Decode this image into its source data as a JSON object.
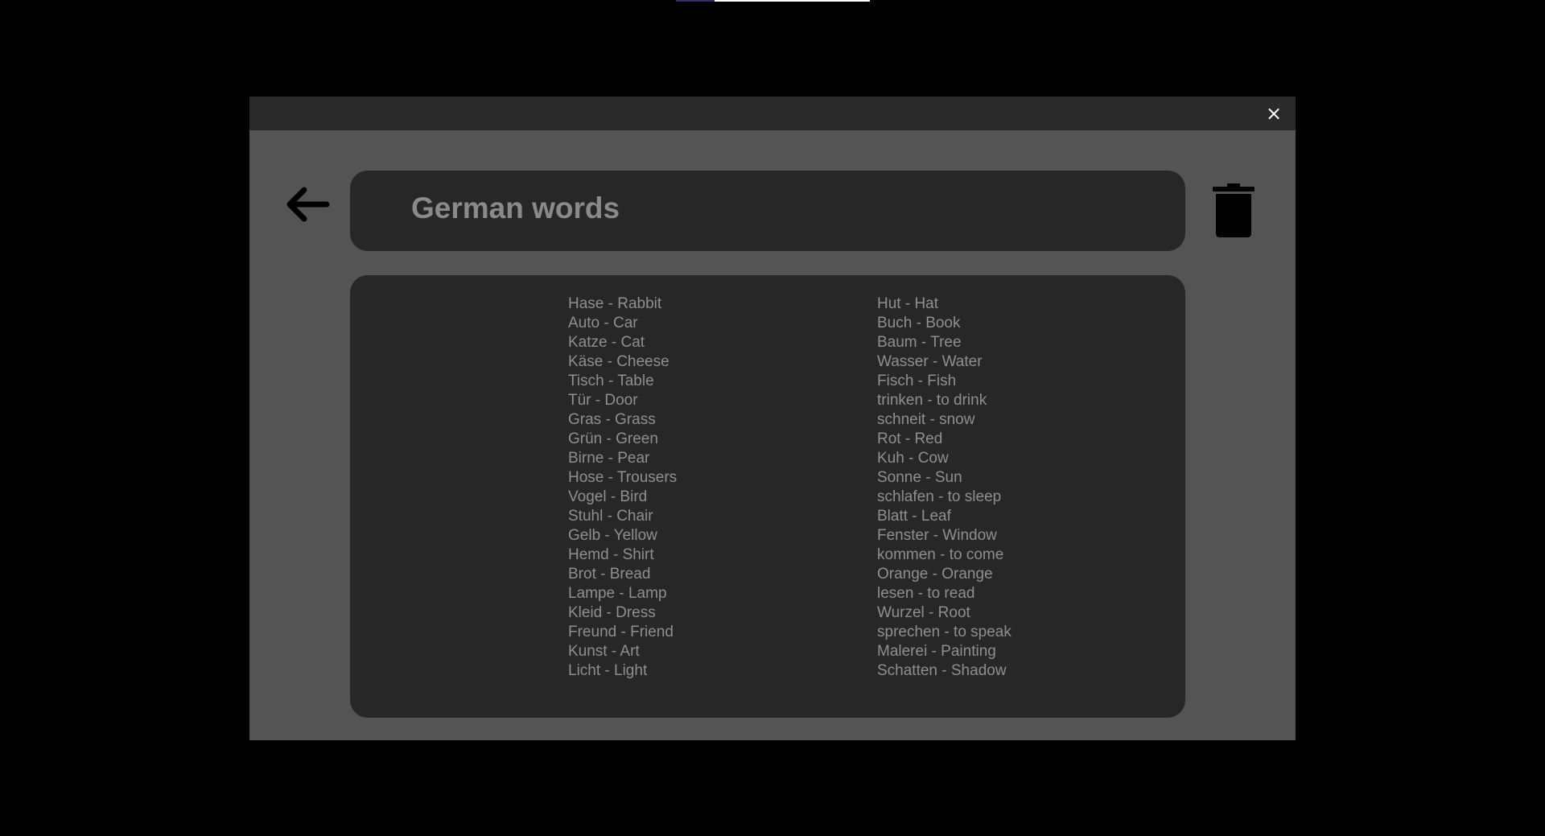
{
  "colors": {
    "background": "#000000",
    "modal": "#545454",
    "titlebar": "#2a2a2a",
    "panel": "#272727",
    "text": "#8f8f8f"
  },
  "modal": {
    "close_label": "×",
    "back_icon": "arrow-left-icon",
    "delete_icon": "trash-icon",
    "title": "German words"
  },
  "words": {
    "left": [
      "Hase - Rabbit",
      "Auto - Car",
      "Katze - Cat",
      "Käse - Cheese",
      "Tisch - Table",
      "Tür - Door",
      "Gras - Grass",
      "Grün - Green",
      "Birne - Pear",
      "Hose - Trousers",
      "Vogel - Bird",
      "Stuhl - Chair",
      "Gelb - Yellow",
      "Hemd - Shirt",
      "Brot - Bread",
      "Lampe - Lamp",
      "Kleid - Dress",
      "Freund - Friend",
      "Kunst - Art",
      "Licht - Light"
    ],
    "right": [
      "Hut - Hat",
      "Buch - Book",
      "Baum - Tree",
      "Wasser - Water",
      "Fisch - Fish",
      "trinken - to drink",
      "schneit - snow",
      "Rot - Red",
      "Kuh - Cow",
      "Sonne - Sun",
      "schlafen - to sleep",
      "Blatt - Leaf",
      "Fenster - Window",
      "kommen - to come",
      "Orange - Orange",
      "lesen - to read",
      "Wurzel - Root",
      "sprechen - to speak",
      "Malerei - Painting",
      "Schatten - Shadow"
    ]
  }
}
